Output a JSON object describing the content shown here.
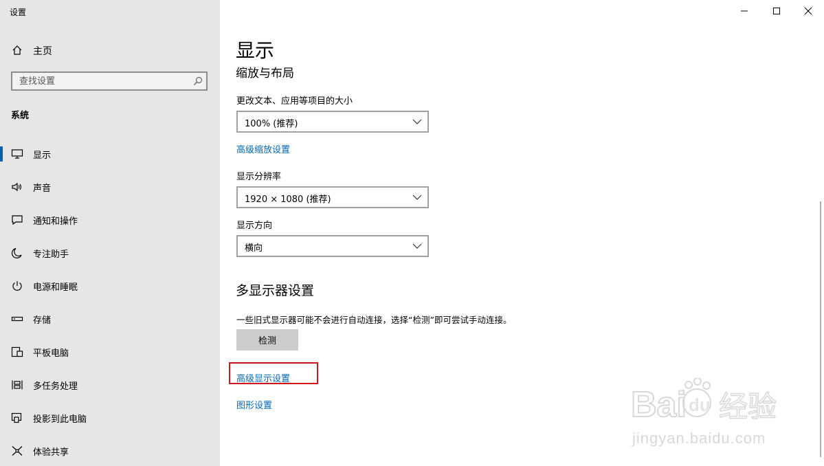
{
  "app": {
    "title": "设置"
  },
  "sidebar": {
    "home_label": "主页",
    "search_placeholder": "查找设置",
    "section_title": "系统",
    "items": [
      {
        "label": "显示",
        "icon": "monitor-icon",
        "active": true
      },
      {
        "label": "声音",
        "icon": "speaker-icon"
      },
      {
        "label": "通知和操作",
        "icon": "notification-icon"
      },
      {
        "label": "专注助手",
        "icon": "moon-icon"
      },
      {
        "label": "电源和睡眠",
        "icon": "power-icon"
      },
      {
        "label": "存储",
        "icon": "storage-icon"
      },
      {
        "label": "平板电脑",
        "icon": "tablet-icon"
      },
      {
        "label": "多任务处理",
        "icon": "multitask-icon"
      },
      {
        "label": "投影到此电脑",
        "icon": "project-icon"
      },
      {
        "label": "体验共享",
        "icon": "share-icon"
      }
    ]
  },
  "main": {
    "title": "显示",
    "scale_section": "缩放与布局",
    "scale_label": "更改文本、应用等项目的大小",
    "scale_value": "100% (推荐)",
    "advanced_scaling_link": "高级缩放设置",
    "resolution_label": "显示分辨率",
    "resolution_value": "1920 × 1080 (推荐)",
    "orientation_label": "显示方向",
    "orientation_value": "横向",
    "multi_display_title": "多显示器设置",
    "multi_display_desc": "一些旧式显示器可能不会进行自动连接，选择“检测”即可尝试手动连接。",
    "detect_button": "检测",
    "advanced_display_link": "高级显示设置",
    "graphics_link": "图形设置"
  },
  "colors": {
    "accent": "#0063b1",
    "link": "#0067b8",
    "highlight": "#d0161d"
  },
  "watermark": {
    "brand": "Baidu经验",
    "url": "jingyan.baidu.com"
  }
}
